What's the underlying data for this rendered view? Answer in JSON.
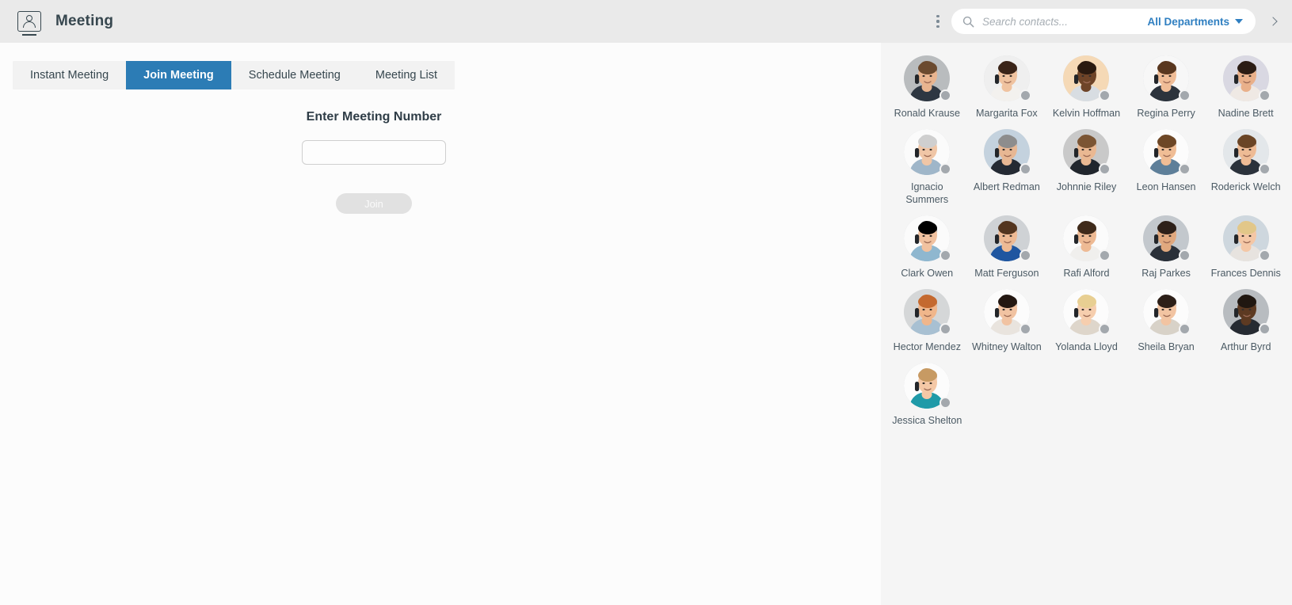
{
  "header": {
    "app_icon": "monitor-person-icon",
    "title": "Meeting",
    "menu_icon": "kebab-menu-icon",
    "chevron_icon": "chevron-right-icon"
  },
  "search": {
    "icon": "search-icon",
    "placeholder": "Search contacts...",
    "value": "",
    "department_label": "All Departments",
    "department_caret": "chevron-down-icon"
  },
  "tabs": [
    {
      "label": "Instant Meeting",
      "active": false
    },
    {
      "label": "Join Meeting",
      "active": true
    },
    {
      "label": "Schedule Meeting",
      "active": false
    },
    {
      "label": "Meeting List",
      "active": false
    }
  ],
  "join_form": {
    "title": "Enter Meeting Number",
    "input_value": "",
    "input_placeholder": "",
    "button_label": "Join",
    "button_enabled": false
  },
  "colors": {
    "accent_blue": "#2c7cb5",
    "link_blue": "#2f7fc1",
    "header_bg": "#eaeaea",
    "left_bg": "#fcfcfc",
    "right_bg": "#f5f5f5",
    "tabbar_bg": "#f2f2f2",
    "status_offline": "#a3a8ad",
    "disabled_button": "#e1e1e1"
  },
  "contacts": [
    {
      "name": "Ronald Krause",
      "status": "offline",
      "bg": "#b9bcbe",
      "skin": "#e8b48f",
      "hair": "#6b4a2f",
      "shirt": "#2e3742"
    },
    {
      "name": "Margarita Fox",
      "status": "offline",
      "bg": "#efefef",
      "skin": "#f0c3a0",
      "hair": "#3a2418",
      "shirt": "#f3f1ee"
    },
    {
      "name": "Kelvin Hoffman",
      "status": "offline",
      "bg": "#f5d9b6",
      "skin": "#6e4428",
      "hair": "#2a1a10",
      "shirt": "#d8dde2"
    },
    {
      "name": "Regina Perry",
      "status": "offline",
      "bg": "#f7f7f7",
      "skin": "#f0bd97",
      "hair": "#59371f",
      "shirt": "#2c333c"
    },
    {
      "name": "Nadine Brett",
      "status": "offline",
      "bg": "#d9d8e2",
      "skin": "#e9b08a",
      "hair": "#2b1c14",
      "shirt": "#efe9e4"
    },
    {
      "name": "Ignacio Summers",
      "status": "offline",
      "bg": "#fbfbfb",
      "skin": "#f0c6a6",
      "hair": "#cfcfcf",
      "shirt": "#9fb6c9"
    },
    {
      "name": "Albert Redman",
      "status": "offline",
      "bg": "#c4d2de",
      "skin": "#e7b793",
      "hair": "#8d8d8d",
      "shirt": "#242a33"
    },
    {
      "name": "Johnnie Riley",
      "status": "offline",
      "bg": "#c9c9c9",
      "skin": "#eab892",
      "hair": "#7b5534",
      "shirt": "#21262d"
    },
    {
      "name": "Leon Hansen",
      "status": "offline",
      "bg": "#fcfcfc",
      "skin": "#f0bd95",
      "hair": "#6d4726",
      "shirt": "#5e7f99"
    },
    {
      "name": "Roderick Welch",
      "status": "offline",
      "bg": "#e3e7ea",
      "skin": "#eebb95",
      "hair": "#6a4526",
      "shirt": "#2b323b"
    },
    {
      "name": "Clark Owen",
      "status": "offline",
      "bg": "#fbfbfb",
      "skin": "#f1c2a0",
      "hair": "#4d3venv",
      "shirt": "#8fb7cf"
    },
    {
      "name": "Matt Ferguson",
      "status": "offline",
      "bg": "#cfd2d5",
      "skin": "#eeba94",
      "hair": "#53351f",
      "shirt": "#1f56a0"
    },
    {
      "name": "Rafi Alford",
      "status": "offline",
      "bg": "#fbfbfb",
      "skin": "#eeba94",
      "hair": "#3f2a1a",
      "shirt": "#f0efed"
    },
    {
      "name": "Raj Parkes",
      "status": "offline",
      "bg": "#c3c8cd",
      "skin": "#e0a87e",
      "hair": "#2d2019",
      "shirt": "#2a3039"
    },
    {
      "name": "Frances Dennis",
      "status": "offline",
      "bg": "#ced7de",
      "skin": "#f4c7a6",
      "hair": "#e2c789",
      "shirt": "#e7e3df"
    },
    {
      "name": "Hector Mendez",
      "status": "offline",
      "bg": "#d5d7d8",
      "skin": "#f0b68b",
      "hair": "#c4692f",
      "shirt": "#a8c0d2"
    },
    {
      "name": "Whitney Walton",
      "status": "offline",
      "bg": "#fcfcfc",
      "skin": "#f1c3a2",
      "hair": "#241812",
      "shirt": "#e9e4de"
    },
    {
      "name": "Yolanda Lloyd",
      "status": "offline",
      "bg": "#fcfcfc",
      "skin": "#f6ceae",
      "hair": "#e8cf92",
      "shirt": "#ded6cb"
    },
    {
      "name": "Sheila Bryan",
      "status": "offline",
      "bg": "#fcfcfc",
      "skin": "#f2c4a2",
      "hair": "#2c1f18",
      "shirt": "#d8d2c8"
    },
    {
      "name": "Arthur Byrd",
      "status": "offline",
      "bg": "#b8bcc0",
      "skin": "#5d3a22",
      "hair": "#201711",
      "shirt": "#262b32"
    },
    {
      "name": "Jessica Shelton",
      "status": "offline",
      "bg": "#fcfcfc",
      "skin": "#f4c8a6",
      "hair": "#c79a63",
      "shirt": "#1f9aa8"
    }
  ]
}
